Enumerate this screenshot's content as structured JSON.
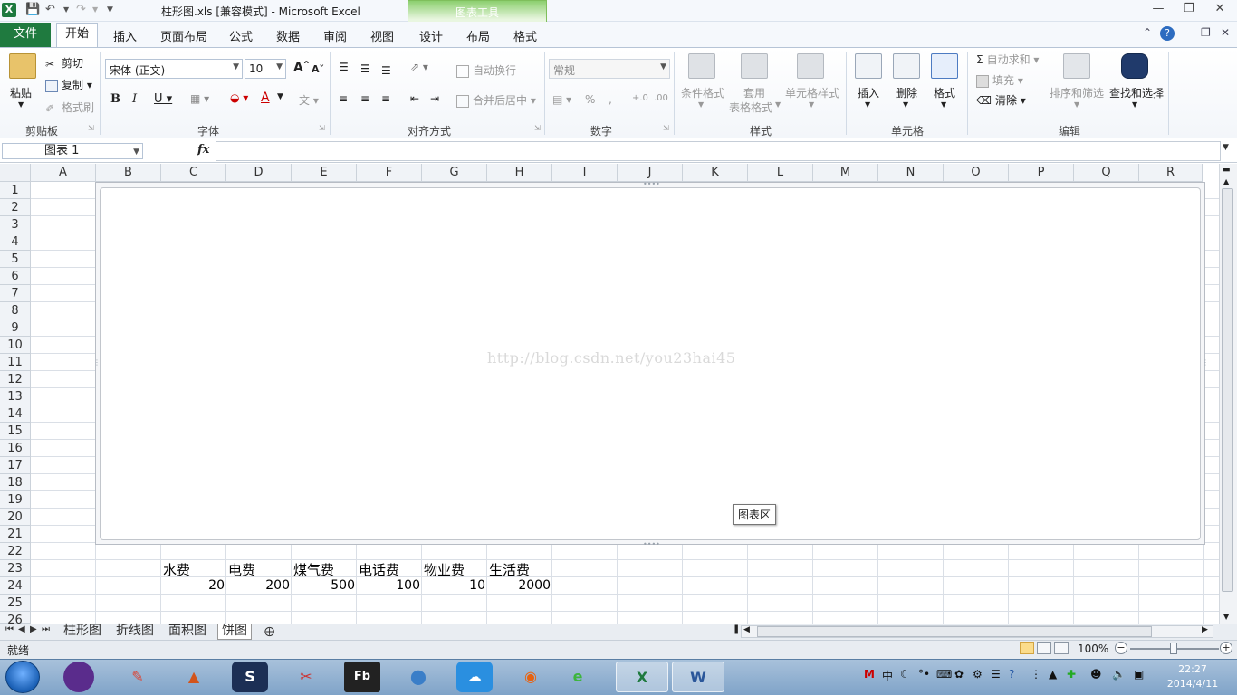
{
  "window": {
    "title": "柱形图.xls  [兼容模式] - Microsoft Excel",
    "chart_tools_label": "图表工具"
  },
  "tabs": {
    "file": "文件",
    "home": "开始",
    "insert": "插入",
    "page_layout": "页面布局",
    "formulas": "公式",
    "data": "数据",
    "review": "审阅",
    "view": "视图",
    "design": "设计",
    "layout": "布局",
    "format": "格式"
  },
  "ribbon": {
    "clipboard": {
      "title": "剪贴板",
      "paste": "粘贴",
      "cut": "剪切",
      "copy": "复制",
      "format_painter": "格式刷"
    },
    "font": {
      "title": "字体",
      "font_name": "宋体 (正文)",
      "font_size": "10"
    },
    "alignment": {
      "title": "对齐方式",
      "wrap_text": "自动换行",
      "merge_center": "合并后居中"
    },
    "number": {
      "title": "数字",
      "format": "常规"
    },
    "styles": {
      "title": "样式",
      "conditional": "条件格式",
      "table_format_1": "套用",
      "table_format_2": "表格格式",
      "cell_styles": "单元格样式"
    },
    "cells": {
      "title": "单元格",
      "insert": "插入",
      "delete": "删除",
      "format": "格式"
    },
    "editing": {
      "title": "编辑",
      "autosum": "自动求和",
      "fill": "填充",
      "clear": "清除",
      "sort_filter": "排序和筛选",
      "find_select": "查找和选择"
    }
  },
  "formula_bar": {
    "name_box": "图表 1",
    "fx": "fx",
    "value": ""
  },
  "columns": [
    "A",
    "B",
    "C",
    "D",
    "E",
    "F",
    "G",
    "H",
    "I",
    "J",
    "K",
    "L",
    "M",
    "N",
    "O",
    "P",
    "Q",
    "R"
  ],
  "rows": [
    "1",
    "2",
    "3",
    "4",
    "5",
    "6",
    "7",
    "8",
    "9",
    "10",
    "11",
    "12",
    "13",
    "14",
    "15",
    "16",
    "17",
    "18",
    "19",
    "20",
    "21",
    "22",
    "23",
    "24",
    "25",
    "26"
  ],
  "cells": {
    "C23": "水费",
    "D23": "电费",
    "E23": "煤气费",
    "F23": "电话费",
    "G23": "物业费",
    "H23": "生活费",
    "C24": "20",
    "D24": "200",
    "E24": "500",
    "F24": "100",
    "G24": "10",
    "H24": "2000"
  },
  "chart": {
    "watermark": "http://blog.csdn.net/you23hai45",
    "tooltip": "图表区"
  },
  "sheets": [
    "柱形图",
    "折线图",
    "面积图",
    "饼图"
  ],
  "active_sheet": "饼图",
  "status": {
    "ready": "就绪",
    "zoom": "100%"
  },
  "taskbar": {
    "time": "22:27",
    "date": "2014/4/11"
  }
}
